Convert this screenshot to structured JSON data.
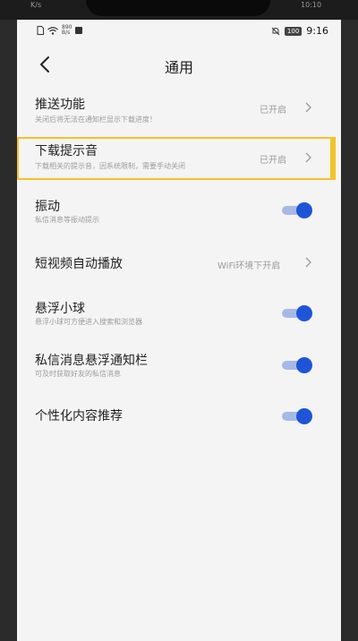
{
  "outer_status": {
    "left": "K/s",
    "right": "10:10"
  },
  "status_bar": {
    "net_speed": "890",
    "net_unit": "B/s",
    "battery": "100",
    "time": "9:16"
  },
  "header": {
    "title": "通用"
  },
  "settings": [
    {
      "label": "推送功能",
      "sub": "关闭后将无法在通知栏显示下载进度！",
      "value": "已开启",
      "control": "chevron"
    },
    {
      "label": "下载提示音",
      "sub": "下载相关的提示音，因系统限制，需要手动关闭",
      "value": "已开启",
      "control": "chevron"
    },
    {
      "label": "振动",
      "sub": "私信消息等振动提示",
      "control": "toggle",
      "on": true
    },
    {
      "label": "短视频自动播放",
      "value": "WiFi环境下开启",
      "control": "chevron"
    },
    {
      "label": "悬浮小球",
      "sub": "悬浮小球可方便进入搜索和浏览器",
      "control": "toggle",
      "on": true
    },
    {
      "label": "私信消息悬浮通知栏",
      "sub": "可及时获取好友的私信消息",
      "control": "toggle",
      "on": true
    },
    {
      "label": "个性化内容推荐",
      "control": "toggle",
      "on": true
    }
  ],
  "colors": {
    "accent": "#1e55d8",
    "toggle_track": "#a7b9e6",
    "highlight": "#f4c229"
  }
}
